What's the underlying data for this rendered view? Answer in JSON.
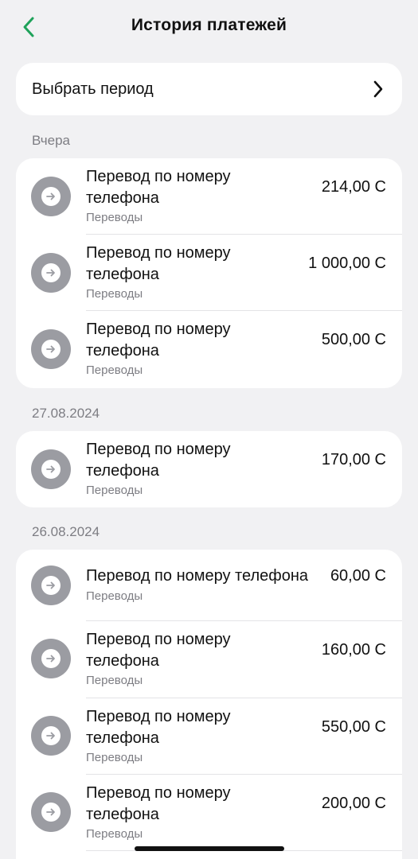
{
  "header": {
    "title": "История платежей"
  },
  "period": {
    "label": "Выбрать период"
  },
  "groups": [
    {
      "label": "Вчера",
      "items": [
        {
          "name": "Перевод по номеру телефона",
          "category": "Переводы",
          "amount": "214,00 С"
        },
        {
          "name": "Перевод по номеру телефона",
          "category": "Переводы",
          "amount": "1 000,00 С"
        },
        {
          "name": "Перевод по номеру телефона",
          "category": "Переводы",
          "amount": "500,00 С"
        }
      ]
    },
    {
      "label": "27.08.2024",
      "items": [
        {
          "name": "Перевод по номеру телефона",
          "category": "Переводы",
          "amount": "170,00 С"
        }
      ]
    },
    {
      "label": "26.08.2024",
      "items": [
        {
          "name": "Перевод по номеру телефона",
          "category": "Переводы",
          "amount": "60,00 С"
        },
        {
          "name": "Перевод по номеру телефона",
          "category": "Переводы",
          "amount": "160,00 С"
        },
        {
          "name": "Перевод по номеру телефона",
          "category": "Переводы",
          "amount": "550,00 С"
        },
        {
          "name": "Перевод по номеру телефона",
          "category": "Переводы",
          "amount": "200,00 С"
        }
      ]
    }
  ],
  "colors": {
    "accent": "#1fa25a",
    "background": "#f1f1f3",
    "card": "#ffffff",
    "avatar": "#9b9ca2",
    "muted": "#7d7d83"
  },
  "icons": {
    "back": "chevron-left-icon",
    "period": "chevron-right-icon",
    "transfer": "arrow-right-icon"
  }
}
